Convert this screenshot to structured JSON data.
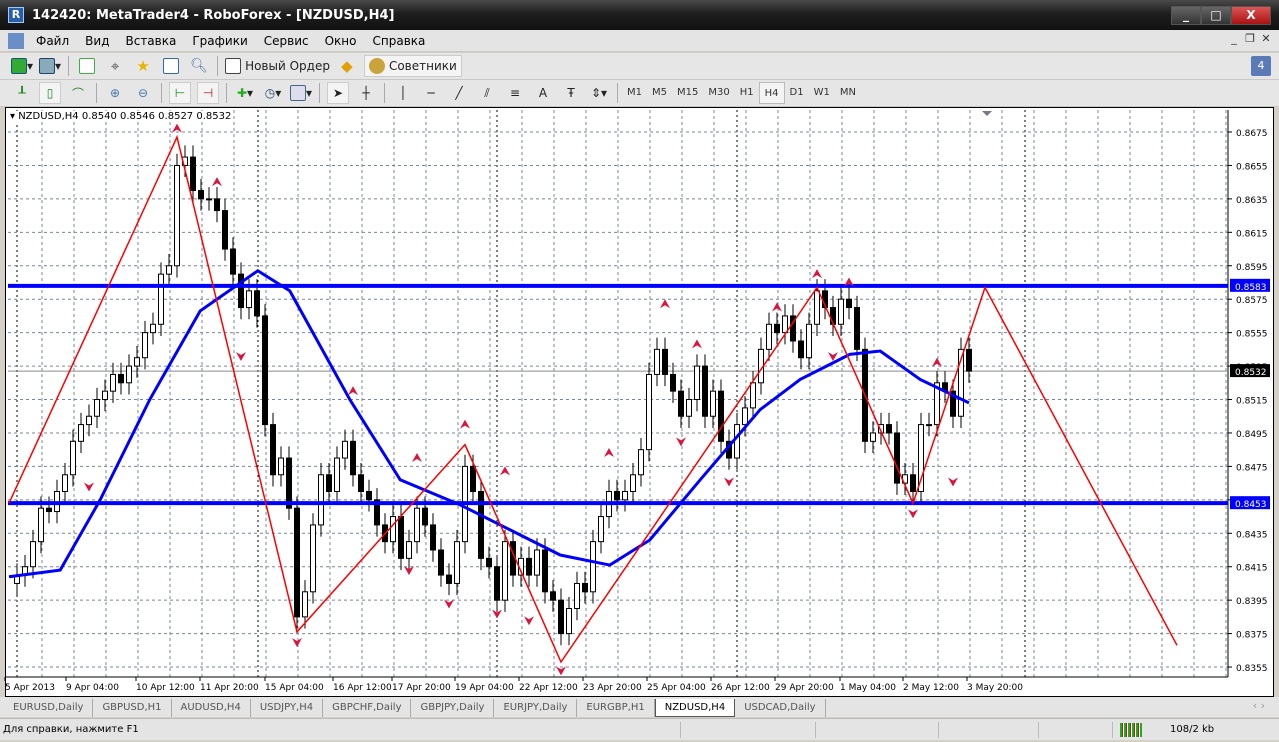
{
  "window": {
    "title": "142420: MetaTrader4 - RoboForex - [NZDUSD,H4]",
    "minimize": "_",
    "maximize": "□",
    "close": "X"
  },
  "menu": [
    "Файл",
    "Вид",
    "Вставка",
    "Графики",
    "Сервис",
    "Окно",
    "Справка"
  ],
  "mdi": {
    "minimize": "_",
    "restore": "❐",
    "close": "✕"
  },
  "toolbar1": {
    "new_order": "Новый Ордер",
    "experts": "Советники",
    "notifications": "4"
  },
  "timeframes": [
    "M1",
    "M5",
    "M15",
    "M30",
    "H1",
    "H4",
    "D1",
    "W1",
    "MN"
  ],
  "active_timeframe": "H4",
  "chart": {
    "header": "NZDUSD,H4  0.8540 0.8546 0.8527 0.8532",
    "symbol": "NZDUSD",
    "period": "H4",
    "open": 0.854,
    "high": 0.8546,
    "low": 0.8527,
    "close": 0.8532,
    "price_labels": [
      "0.8675",
      "0.8655",
      "0.8635",
      "0.8615",
      "0.8595",
      "0.8575",
      "0.8555",
      "0.8535",
      "0.8515",
      "0.8495",
      "0.8475",
      "0.8455",
      "0.8435",
      "0.8415",
      "0.8395",
      "0.8375",
      "0.8355"
    ],
    "time_labels": [
      "5 Apr 2013",
      "9 Apr 04:00",
      "10 Apr 12:00",
      "11 Apr 20:00",
      "15 Apr 04:00",
      "16 Apr 12:00",
      "17 Apr 20:00",
      "19 Apr 04:00",
      "22 Apr 12:00",
      "23 Apr 20:00",
      "25 Apr 04:00",
      "26 Apr 12:00",
      "29 Apr 20:00",
      "1 May 04:00",
      "2 May 12:00",
      "3 May 20:00"
    ],
    "levels": [
      {
        "price": "0.8583",
        "color": "#0000ff"
      },
      {
        "price": "0.8453",
        "color": "#0000ff"
      }
    ],
    "current_price": "0.8532",
    "colors": {
      "zigzag": "#ff0000",
      "ma": "#0000ff",
      "fractal": "#dc143c",
      "grid": "#778899",
      "bull": "#ffffff",
      "bear": "#000000"
    },
    "closes": [
      0.841,
      0.8415,
      0.843,
      0.845,
      0.8448,
      0.846,
      0.847,
      0.849,
      0.85,
      0.8505,
      0.8515,
      0.852,
      0.853,
      0.8525,
      0.8535,
      0.854,
      0.8555,
      0.856,
      0.859,
      0.8595,
      0.8655,
      0.866,
      0.864,
      0.8635,
      0.8635,
      0.8628,
      0.8605,
      0.859,
      0.857,
      0.858,
      0.8565,
      0.85,
      0.847,
      0.848,
      0.845,
      0.8385,
      0.84,
      0.844,
      0.847,
      0.846,
      0.848,
      0.849,
      0.847,
      0.846,
      0.8455,
      0.844,
      0.843,
      0.8445,
      0.842,
      0.843,
      0.845,
      0.844,
      0.8425,
      0.841,
      0.8405,
      0.843,
      0.8475,
      0.846,
      0.842,
      0.8415,
      0.8395,
      0.843,
      0.841,
      0.842,
      0.841,
      0.8425,
      0.84,
      0.8395,
      0.8375,
      0.839,
      0.8405,
      0.84,
      0.843,
      0.8445,
      0.846,
      0.8455,
      0.846,
      0.847,
      0.8485,
      0.853,
      0.8545,
      0.853,
      0.852,
      0.8505,
      0.8515,
      0.8535,
      0.8505,
      0.852,
      0.849,
      0.848,
      0.85,
      0.851,
      0.8525,
      0.8545,
      0.856,
      0.8555,
      0.8565,
      0.855,
      0.854,
      0.856,
      0.858,
      0.857,
      0.856,
      0.8575,
      0.857,
      0.8545,
      0.849,
      0.8495,
      0.85,
      0.8495,
      0.8465,
      0.847,
      0.846,
      0.85,
      0.85,
      0.8525,
      0.852,
      0.8505,
      0.8545,
      0.8532
    ],
    "ma": [
      [
        -1,
        0.8409
      ],
      [
        5.4,
        0.8413
      ],
      [
        10.4,
        0.8455
      ],
      [
        16.6,
        0.8515
      ],
      [
        22.9,
        0.8568
      ],
      [
        30.1,
        0.8592
      ],
      [
        34.1,
        0.858
      ],
      [
        41.6,
        0.8515
      ],
      [
        47.9,
        0.8467
      ],
      [
        55.4,
        0.8452
      ],
      [
        60.4,
        0.844
      ],
      [
        67.9,
        0.8422
      ],
      [
        74.1,
        0.8416
      ],
      [
        79.1,
        0.8431
      ],
      [
        85.4,
        0.8467
      ],
      [
        92.9,
        0.8509
      ],
      [
        97.9,
        0.8527
      ],
      [
        104.1,
        0.8542
      ],
      [
        107.9,
        0.8544
      ],
      [
        112.9,
        0.8527
      ],
      [
        119,
        0.8513
      ]
    ],
    "zigzag": [
      [
        -1,
        0.8453
      ],
      [
        20,
        0.8672
      ],
      [
        35,
        0.8376
      ],
      [
        56,
        0.8488
      ],
      [
        68,
        0.8358
      ],
      [
        100,
        0.8582
      ],
      [
        112,
        0.8453
      ],
      [
        121,
        0.8582
      ],
      [
        145,
        0.8368
      ]
    ],
    "fractals_up": [
      [
        20,
        0.8677
      ],
      [
        25,
        0.8645
      ],
      [
        42,
        0.852
      ],
      [
        50,
        0.848
      ],
      [
        56,
        0.85
      ],
      [
        61,
        0.8472
      ],
      [
        74,
        0.8483
      ],
      [
        81,
        0.8572
      ],
      [
        85,
        0.8548
      ],
      [
        95,
        0.857
      ],
      [
        100,
        0.859
      ],
      [
        104,
        0.8585
      ],
      [
        115,
        0.8537
      ]
    ],
    "fractals_down": [
      [
        9,
        0.8463
      ],
      [
        28,
        0.8541
      ],
      [
        35,
        0.837
      ],
      [
        49,
        0.8413
      ],
      [
        54,
        0.8393
      ],
      [
        60,
        0.8387
      ],
      [
        64,
        0.8383
      ],
      [
        68,
        0.8353
      ],
      [
        83,
        0.849
      ],
      [
        89,
        0.8466
      ],
      [
        102,
        0.8541
      ],
      [
        112,
        0.8447
      ],
      [
        117,
        0.8466
      ]
    ]
  },
  "tabs": [
    "EURUSD,Daily",
    "GBPUSD,H1",
    "AUDUSD,H4",
    "USDJPY,H4",
    "GBPCHF,Daily",
    "GBPJPY,Daily",
    "EURJPY,Daily",
    "EURGBP,H1",
    "NZDUSD,H4",
    "USDCAD,Daily"
  ],
  "active_tab": "NZDUSD,H4",
  "status": {
    "help": "Для справки, нажмите F1",
    "traffic": "108/2 kb"
  }
}
